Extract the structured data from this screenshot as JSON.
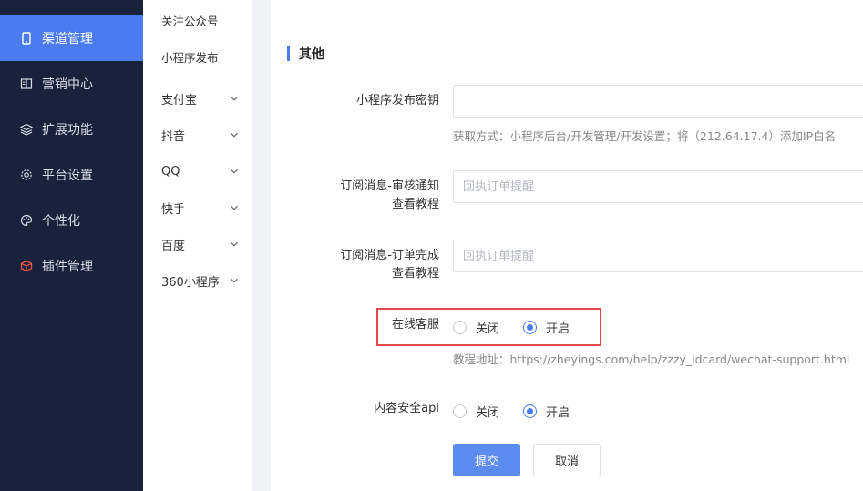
{
  "sidebar": {
    "items": [
      {
        "label": "渠道管理",
        "icon": "phone-icon",
        "active": true
      },
      {
        "label": "营销中心",
        "icon": "book-icon"
      },
      {
        "label": "扩展功能",
        "icon": "layers-icon"
      },
      {
        "label": "平台设置",
        "icon": "gear-icon"
      },
      {
        "label": "个性化",
        "icon": "palette-icon"
      },
      {
        "label": "插件管理",
        "icon": "cube-icon"
      }
    ]
  },
  "submenu": {
    "items": [
      {
        "label": "关注公众号",
        "expandable": false
      },
      {
        "label": "小程序发布",
        "expandable": false
      },
      {
        "label": "支付宝",
        "expandable": true
      },
      {
        "label": "抖音",
        "expandable": true
      },
      {
        "label": "QQ",
        "expandable": true
      },
      {
        "label": "快手",
        "expandable": true
      },
      {
        "label": "百度",
        "expandable": true
      },
      {
        "label": "360小程序",
        "expandable": true
      }
    ]
  },
  "section": {
    "title": "其他"
  },
  "form": {
    "publish_key": {
      "label": "小程序发布密钥",
      "value": "",
      "placeholder": "",
      "help": "获取方式：小程序后台/开发管理/开发设置；将（212.64.17.4）添加IP白名"
    },
    "sub_audit": {
      "label_line1": "订阅消息-审核通知",
      "label_line2": "查看教程",
      "placeholder": "回执订单提醒"
    },
    "sub_order": {
      "label_line1": "订阅消息-订单完成",
      "label_line2": "查看教程",
      "placeholder": "回执订单提醒"
    },
    "online_service": {
      "label": "在线客服",
      "options": [
        "关闭",
        "开启"
      ],
      "selected": "开启",
      "help": "教程地址：https://zheyings.com/help/zzzy_idcard/wechat-support.html"
    },
    "content_security": {
      "label": "内容安全api",
      "options": [
        "关闭",
        "开启"
      ],
      "selected": "开启"
    }
  },
  "actions": {
    "submit_label": "提交",
    "cancel_label": "取消"
  },
  "colors": {
    "sidebar_bg": "#18223a",
    "accent": "#4a7cf0",
    "highlight": "#e5484d"
  }
}
